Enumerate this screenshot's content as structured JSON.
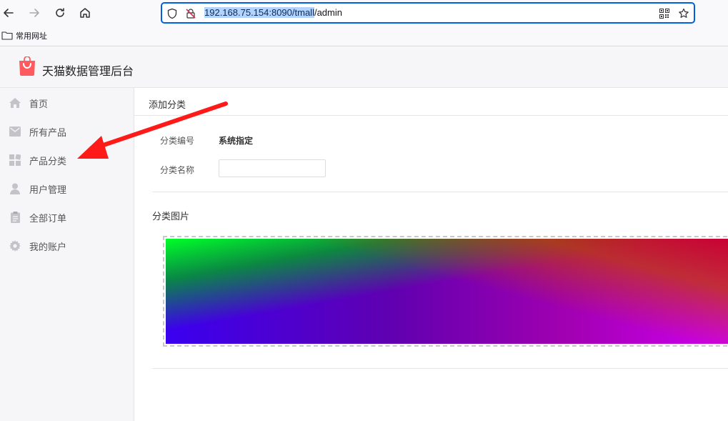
{
  "browser": {
    "url_selected": "192.168.75.154:8090/tmall",
    "url_rest": "/admin",
    "bookmark_label": "常用网址"
  },
  "app": {
    "title": "天猫数据管理后台",
    "brand_color": "#ff5a5f"
  },
  "sidebar": {
    "items": [
      {
        "label": "首页",
        "icon": "home-icon"
      },
      {
        "label": "所有产品",
        "icon": "mail-icon"
      },
      {
        "label": "产品分类",
        "icon": "grid-icon"
      },
      {
        "label": "用户管理",
        "icon": "user-icon"
      },
      {
        "label": "全部订单",
        "icon": "clipboard-icon"
      },
      {
        "label": "我的账户",
        "icon": "gear-icon"
      }
    ]
  },
  "main": {
    "page_title": "添加分类",
    "form": {
      "id_label": "分类编号",
      "id_value": "系统指定",
      "name_label": "分类名称",
      "name_value": ""
    },
    "image_section_title": "分类图片"
  },
  "annotation": {
    "arrow_color": "#ff1a1a"
  }
}
